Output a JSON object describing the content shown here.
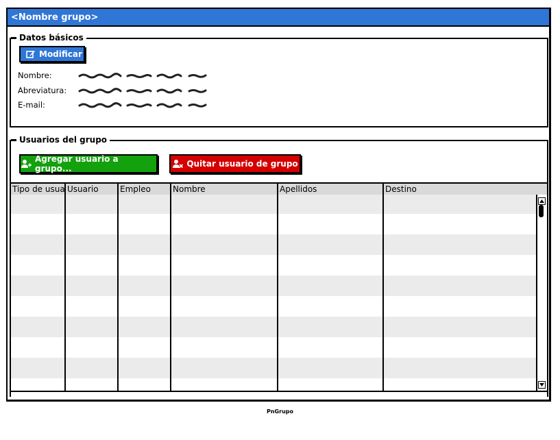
{
  "window": {
    "title": "<Nombre grupo>"
  },
  "datos": {
    "legend": "Datos básicos",
    "modify_label": "Modificar",
    "fields": [
      {
        "label": "Nombre:"
      },
      {
        "label": "Abreviatura:"
      },
      {
        "label": "E-mail:"
      }
    ]
  },
  "usuarios": {
    "legend": "Usuarios del grupo",
    "add_label": "Agregar usuario a grupo...",
    "remove_label": "Quitar usuario de grupo",
    "columns": [
      "Tipo de usua",
      "Usuario",
      "Empleo",
      "Nombre",
      "Apellidos",
      "Destino"
    ]
  },
  "footer": {
    "caption": "PnGrupo"
  },
  "colors": {
    "title_bar": "#2f76d6",
    "add_button": "#13a10e",
    "remove_button": "#d40000",
    "row_alt": "#ebebeb"
  }
}
